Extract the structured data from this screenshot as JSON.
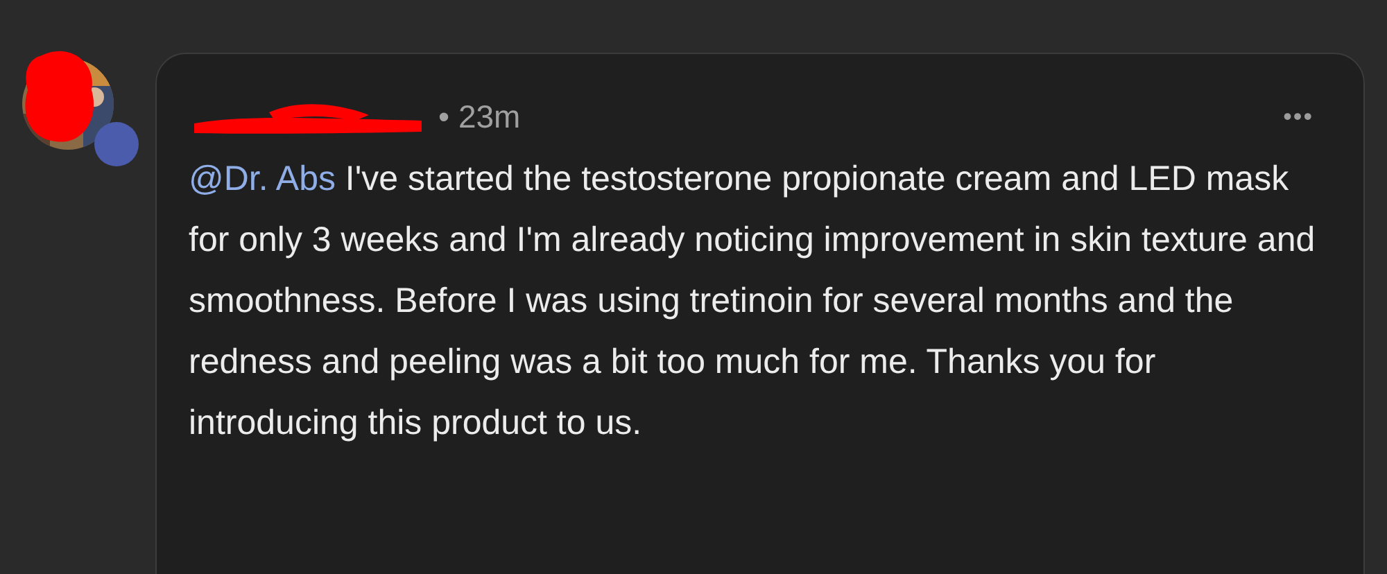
{
  "comment": {
    "time": "• 23m",
    "mention": "@Dr. Abs",
    "body": "I've started the testosterone propionate cream and LED mask for only 3 weeks and I'm already noticing improvement in skin texture and smoothness. Before I was using tretinoin for several months and the redness and peeling was a bit too much for me. Thanks you for introducing this product to us.",
    "menu": "•••"
  }
}
